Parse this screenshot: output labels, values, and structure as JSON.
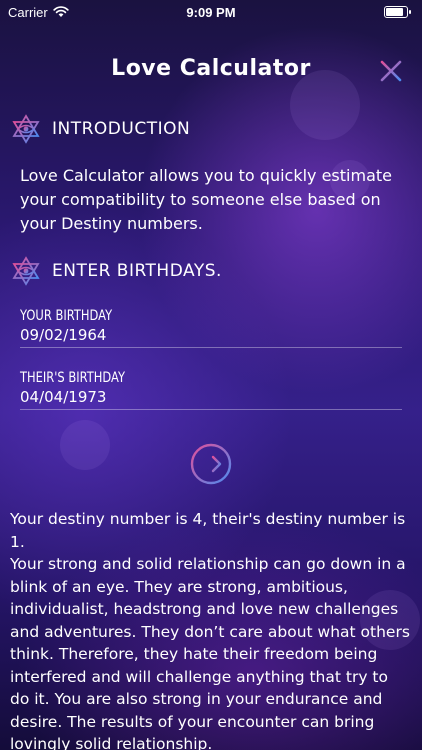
{
  "status_bar": {
    "carrier": "Carrier",
    "time": "9:09 PM",
    "battery_level": 0.9
  },
  "header": {
    "title": "Love Calculator",
    "close_icon": "close-icon"
  },
  "intro": {
    "heading": "INTRODUCTION",
    "icon": "eye-star-icon",
    "text": "Love Calculator allows you to quickly estimate your compatibility to someone else based on your Destiny numbers."
  },
  "birthdays": {
    "heading": "ENTER BIRTHDAYS.",
    "icon": "eye-star-icon",
    "your_label": "YOUR BIRTHDAY",
    "your_value": "09/02/1964",
    "their_label": "THEIR'S BIRTHDAY",
    "their_value": "04/04/1973"
  },
  "submit": {
    "icon": "arrow-right-circle-icon"
  },
  "result": {
    "summary": "Your destiny number is 4, their's destiny number is 1.",
    "description": "Your strong and solid relationship can go down in a blink of an eye. They are strong, ambitious, individualist, headstrong and love new challenges and adventures. They don’t care about what others think. Therefore, they hate their freedom being interfered and will challenge anything that try to do it. You are also strong in your endurance and desire. The results of your encounter can bring lovingly solid relationship."
  },
  "colors": {
    "accent_pink": "#e0509a",
    "accent_blue": "#4d8cf0",
    "accent_purple": "#a05ae6"
  }
}
